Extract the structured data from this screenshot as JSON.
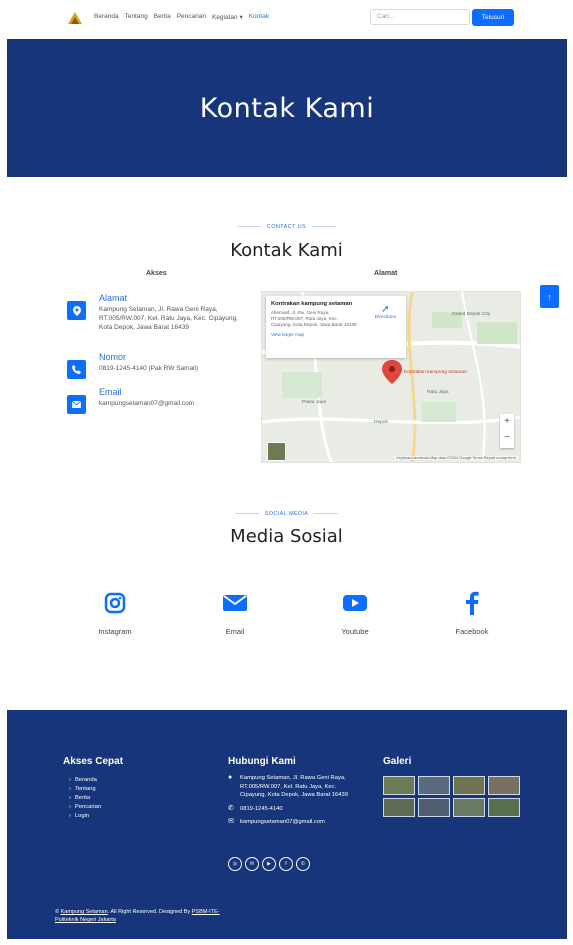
{
  "nav": {
    "items": [
      "Beranda",
      "Tentang",
      "Berita",
      "Pencarian",
      "Kegiatan ▾",
      "Kontak"
    ],
    "search_placeholder": "Cari...",
    "search_button": "Telusuri"
  },
  "hero": {
    "title": "Kontak Kami"
  },
  "contact": {
    "eyebrow": "CONTACT US",
    "title": "Kontak Kami",
    "akses_label": "Akses",
    "alamat_label": "Alamat",
    "items": [
      {
        "head": "Alamat",
        "body": "Kampung Setaman, Jl. Rawa Geni Raya, RT.005/RW.007, Kel. Ratu Jaya, Kec. Cipayung, Kota Depok, Jawa Barat 16439"
      },
      {
        "head": "Nomor",
        "body": "0819-1245-4140 (Pak RW Samali)"
      },
      {
        "head": "Email",
        "body": "kampungsetaman07@gmail.com"
      }
    ],
    "map": {
      "card_title": "Kontrakan kampung setaman",
      "card_address": "Alternatif, Jl. Rw. Geni Raya, RT.005/RW.007, Ratu Jaya, Kec. Cipayung, Kota Depok, Jawa Barat 16439",
      "card_link": "View larger map",
      "directions": "Directions",
      "places": [
        "Pasar Jaya",
        "Grand Depok City",
        "Kontrakan kampung setaman",
        "Ratu Jaya",
        "Depok"
      ],
      "attribution": "Keyboard shortcuts   Map data ©2024 Google   Terms   Report a map error"
    }
  },
  "social": {
    "eyebrow": "SOCIAL MEDIA",
    "title": "Media Sosial",
    "items": [
      "Instagram",
      "Email",
      "Youtube",
      "Facebook"
    ]
  },
  "footer": {
    "quick_title": "Akses Cepat",
    "quick_links": [
      "Beranda",
      "Tentang",
      "Berita",
      "Pencarian",
      "Login"
    ],
    "contact_title": "Hubungi Kami",
    "contact_address": "Kampung Setaman, Jl. Rawa Geni Raya, RT.005/RW.007, Kel. Ratu Jaya, Kec. Cipayung, Kota Depok, Jawa Barat 16439",
    "contact_phone": "0819-1245-4140",
    "contact_email": "kampungsetaman07@gmail.com",
    "gallery_title": "Galeri",
    "copyright_prefix": "© ",
    "copyright_site": "Kampung Setaman",
    "copyright_middle": ". All Right Reserved. Designed By ",
    "copyright_designer": "PSBM-ITE-",
    "copyright_line2": "Politeknik Negeri Jakarta"
  }
}
